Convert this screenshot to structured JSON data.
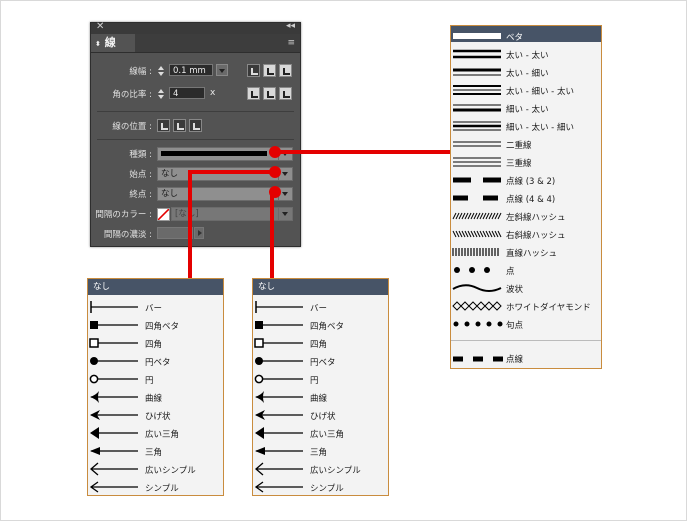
{
  "panel": {
    "close": "✕",
    "collapse": "◂◂",
    "tab": "線",
    "menu": "≡",
    "weight_label": "線幅 :",
    "weight_value": "0.1 mm",
    "miter_label": "角の比率 :",
    "miter_value": "4",
    "miter_unit": "x",
    "align_label": "線の位置 :",
    "type_label": "種類 :",
    "start_label": "始点 :",
    "start_value": "なし",
    "end_label": "終点 :",
    "end_value": "なし",
    "gap_color_label": "間隔のカラー :",
    "gap_color_value": "[なし]",
    "gap_tint_label": "間隔の濃淡 :"
  },
  "accent_color": "#e40000",
  "list_header_color": "#475467",
  "list_border_color": "#c98c3e",
  "type_list": {
    "items": [
      {
        "label": "ベタ",
        "icon": "solid"
      },
      {
        "label": "太い - 太い",
        "icon": "thick-thick"
      },
      {
        "label": "太い - 細い",
        "icon": "thick-thin"
      },
      {
        "label": "太い - 細い - 太い",
        "icon": "thick-thin-thick"
      },
      {
        "label": "細い - 太い",
        "icon": "thin-thick"
      },
      {
        "label": "細い - 太い - 細い",
        "icon": "thin-thick-thin"
      },
      {
        "label": "二重線",
        "icon": "double"
      },
      {
        "label": "三重線",
        "icon": "triple"
      },
      {
        "label": "点線 (3 & 2)",
        "icon": "dash-3-2"
      },
      {
        "label": "点線 (4 & 4)",
        "icon": "dash-4-4"
      },
      {
        "label": "左斜線ハッシュ",
        "icon": "left-hash"
      },
      {
        "label": "右斜線ハッシュ",
        "icon": "right-hash"
      },
      {
        "label": "直線ハッシュ",
        "icon": "straight-hash"
      },
      {
        "label": "点",
        "icon": "dots"
      },
      {
        "label": "波状",
        "icon": "wavy"
      },
      {
        "label": "ホワイトダイヤモンド",
        "icon": "white-diamond"
      },
      {
        "label": "句点",
        "icon": "small-dots"
      },
      {
        "label": "点線",
        "icon": "dashed"
      }
    ]
  },
  "start_list": {
    "header": "なし",
    "items": [
      {
        "label": "バー",
        "icon": "bar"
      },
      {
        "label": "四角ベタ",
        "icon": "square-solid"
      },
      {
        "label": "四角",
        "icon": "square"
      },
      {
        "label": "円ベタ",
        "icon": "circle-solid"
      },
      {
        "label": "円",
        "icon": "circle"
      },
      {
        "label": "曲線",
        "icon": "curved"
      },
      {
        "label": "ひげ状",
        "icon": "barbed"
      },
      {
        "label": "広い三角",
        "icon": "wide-triangle"
      },
      {
        "label": "三角",
        "icon": "triangle"
      },
      {
        "label": "広いシンプル",
        "icon": "wide-simple"
      },
      {
        "label": "シンプル",
        "icon": "simple"
      }
    ]
  },
  "end_list": {
    "header": "なし",
    "items": [
      {
        "label": "バー",
        "icon": "bar"
      },
      {
        "label": "四角ベタ",
        "icon": "square-solid"
      },
      {
        "label": "四角",
        "icon": "square"
      },
      {
        "label": "円ベタ",
        "icon": "circle-solid"
      },
      {
        "label": "円",
        "icon": "circle"
      },
      {
        "label": "曲線",
        "icon": "curved"
      },
      {
        "label": "ひげ状",
        "icon": "barbed"
      },
      {
        "label": "広い三角",
        "icon": "wide-triangle"
      },
      {
        "label": "三角",
        "icon": "triangle"
      },
      {
        "label": "広いシンプル",
        "icon": "wide-simple"
      },
      {
        "label": "シンプル",
        "icon": "simple"
      }
    ]
  }
}
